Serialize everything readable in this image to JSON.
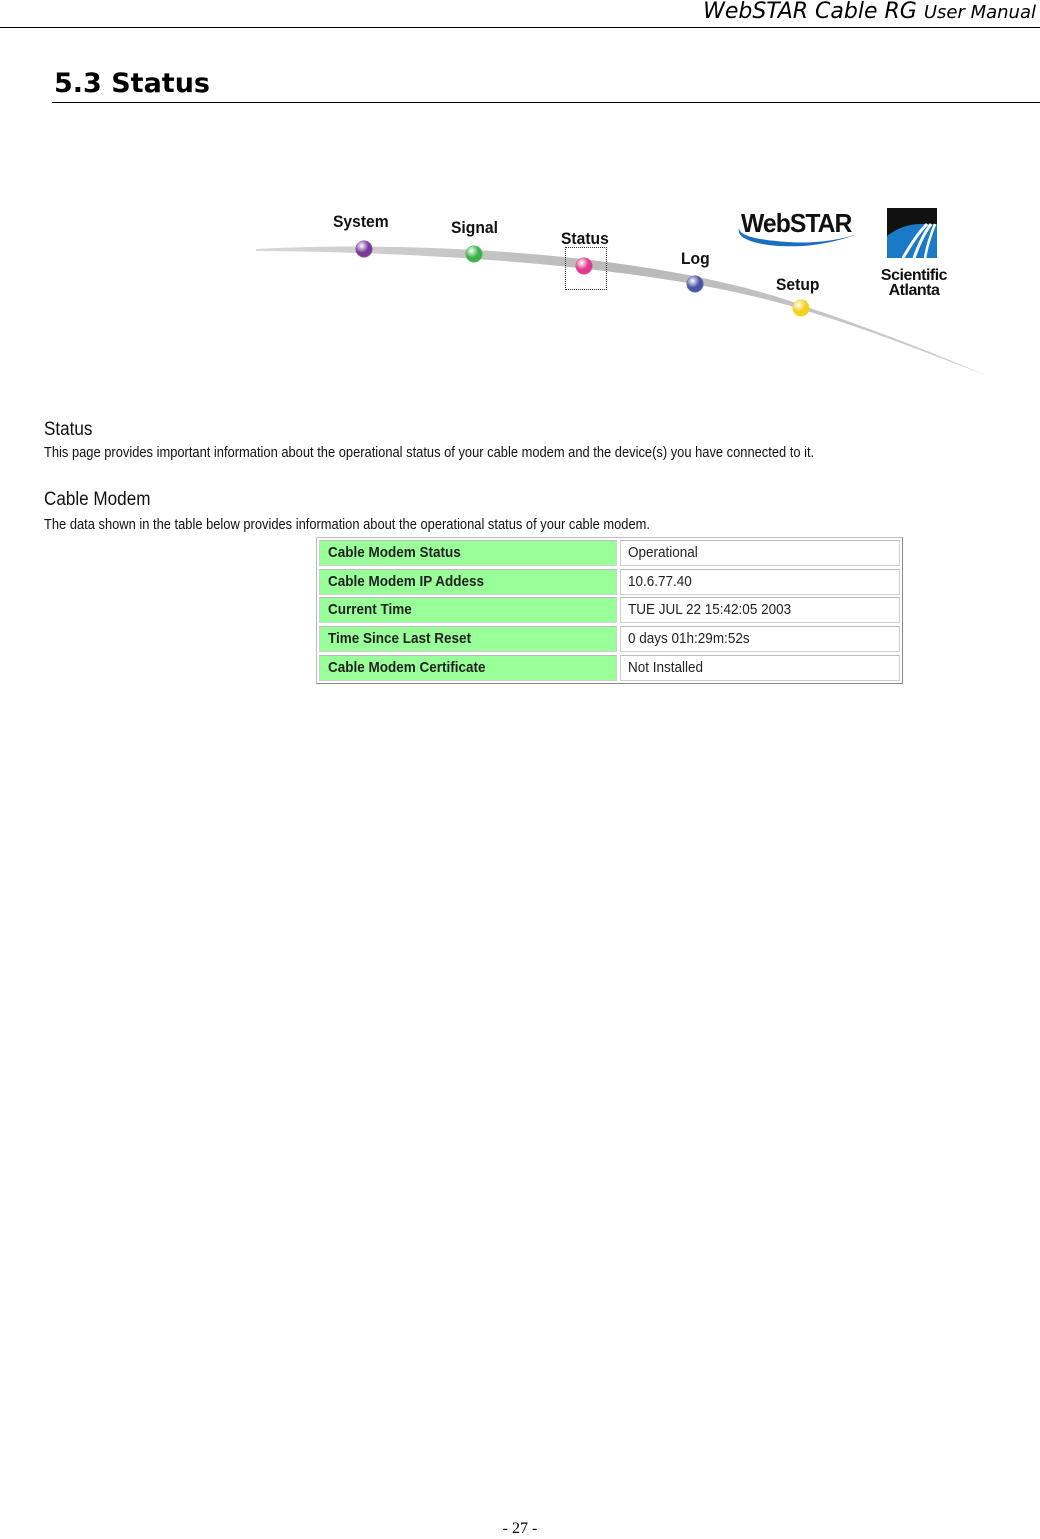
{
  "running_header": {
    "title_main": "WebSTAR Cable RG",
    "title_suffix": "User Manual"
  },
  "section": {
    "title": "5.3 Status"
  },
  "nav": {
    "items": [
      {
        "label": "System",
        "color": "#7a3a9a"
      },
      {
        "label": "Signal",
        "color": "#3cb34a"
      },
      {
        "label": "Status",
        "color": "#e0398e",
        "selected": true
      },
      {
        "label": "Log",
        "color": "#4a55a8"
      },
      {
        "label": "Setup",
        "color": "#f2d21e"
      }
    ],
    "logos": {
      "webstar": "WebSTAR",
      "scientific_atlanta": [
        "Scientific",
        "Atlanta"
      ]
    }
  },
  "status_intro": {
    "heading": "Status",
    "text": "This page provides important information about the operational status of your cable modem and the device(s) you have connected to it."
  },
  "cable_modem": {
    "heading": "Cable Modem",
    "text": "The data shown in the table below provides information about the operational status of your cable modem.",
    "rows": [
      {
        "label": "Cable Modem Status",
        "value": "Operational"
      },
      {
        "label": "Cable Modem IP Addess",
        "value": "10.6.77.40"
      },
      {
        "label": "Current Time",
        "value": "TUE JUL 22 15:42:05 2003"
      },
      {
        "label": "Time Since Last Reset",
        "value": "0 days 01h:29m:52s"
      },
      {
        "label": "Cable Modem Certificate",
        "value": "Not Installed"
      }
    ]
  },
  "colors": {
    "label_cell_bg": "#99ff99",
    "sa_blue": "#1a7ac8",
    "webstar_swoosh": "#1b6fc0"
  },
  "footer": {
    "page_number": "- 27 -"
  }
}
